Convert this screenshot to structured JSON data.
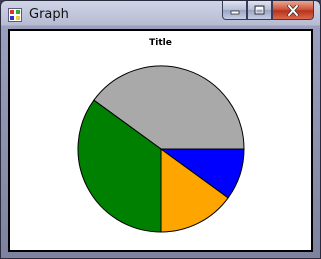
{
  "window": {
    "title": "Graph",
    "caption_buttons": [
      "minimize",
      "maximize",
      "close"
    ]
  },
  "chart_data": {
    "type": "pie",
    "title": "Title",
    "slices": [
      {
        "value": 40,
        "color": "#a9a9a9"
      },
      {
        "value": 35,
        "color": "#008000"
      },
      {
        "value": 15,
        "color": "#ffa500"
      },
      {
        "value": 10,
        "color": "#0000ff"
      }
    ]
  }
}
